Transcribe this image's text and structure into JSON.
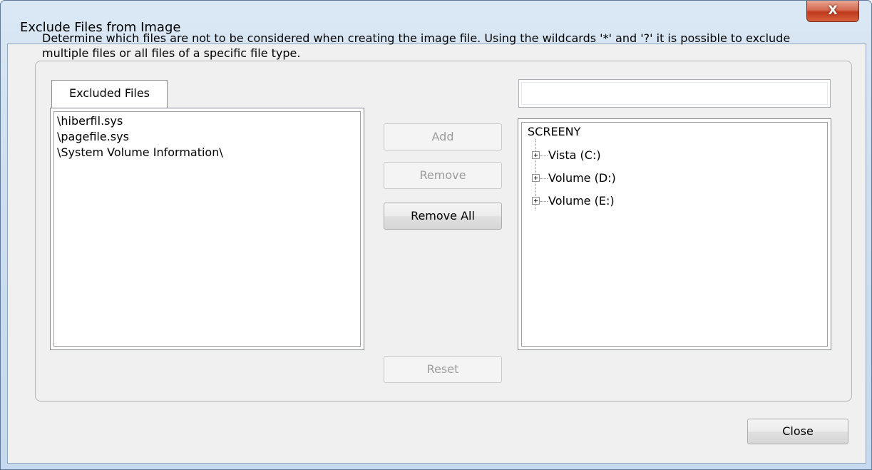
{
  "window": {
    "title": "Exclude Files from Image",
    "close_glyph": "X"
  },
  "description": "Determine which files are not to be considered when creating the image file. Using the wildcards '*' and '?' it is possible to exclude multiple files or all files of a specific file type.",
  "excluded_tab": {
    "label": "Excluded Files",
    "items": [
      "\\hiberfil.sys",
      "\\pagefile.sys",
      "\\System Volume Information\\"
    ]
  },
  "buttons": {
    "add": "Add",
    "remove": "Remove",
    "remove_all": "Remove All",
    "reset": "Reset",
    "close": "Close"
  },
  "path_input": {
    "value": ""
  },
  "tree": {
    "root": "SCREENY",
    "nodes": [
      "Vista (C:)",
      "Volume (D:)",
      "Volume (E:)"
    ]
  },
  "icons": {
    "close": "close-icon",
    "expand": "plus-box-icon"
  }
}
